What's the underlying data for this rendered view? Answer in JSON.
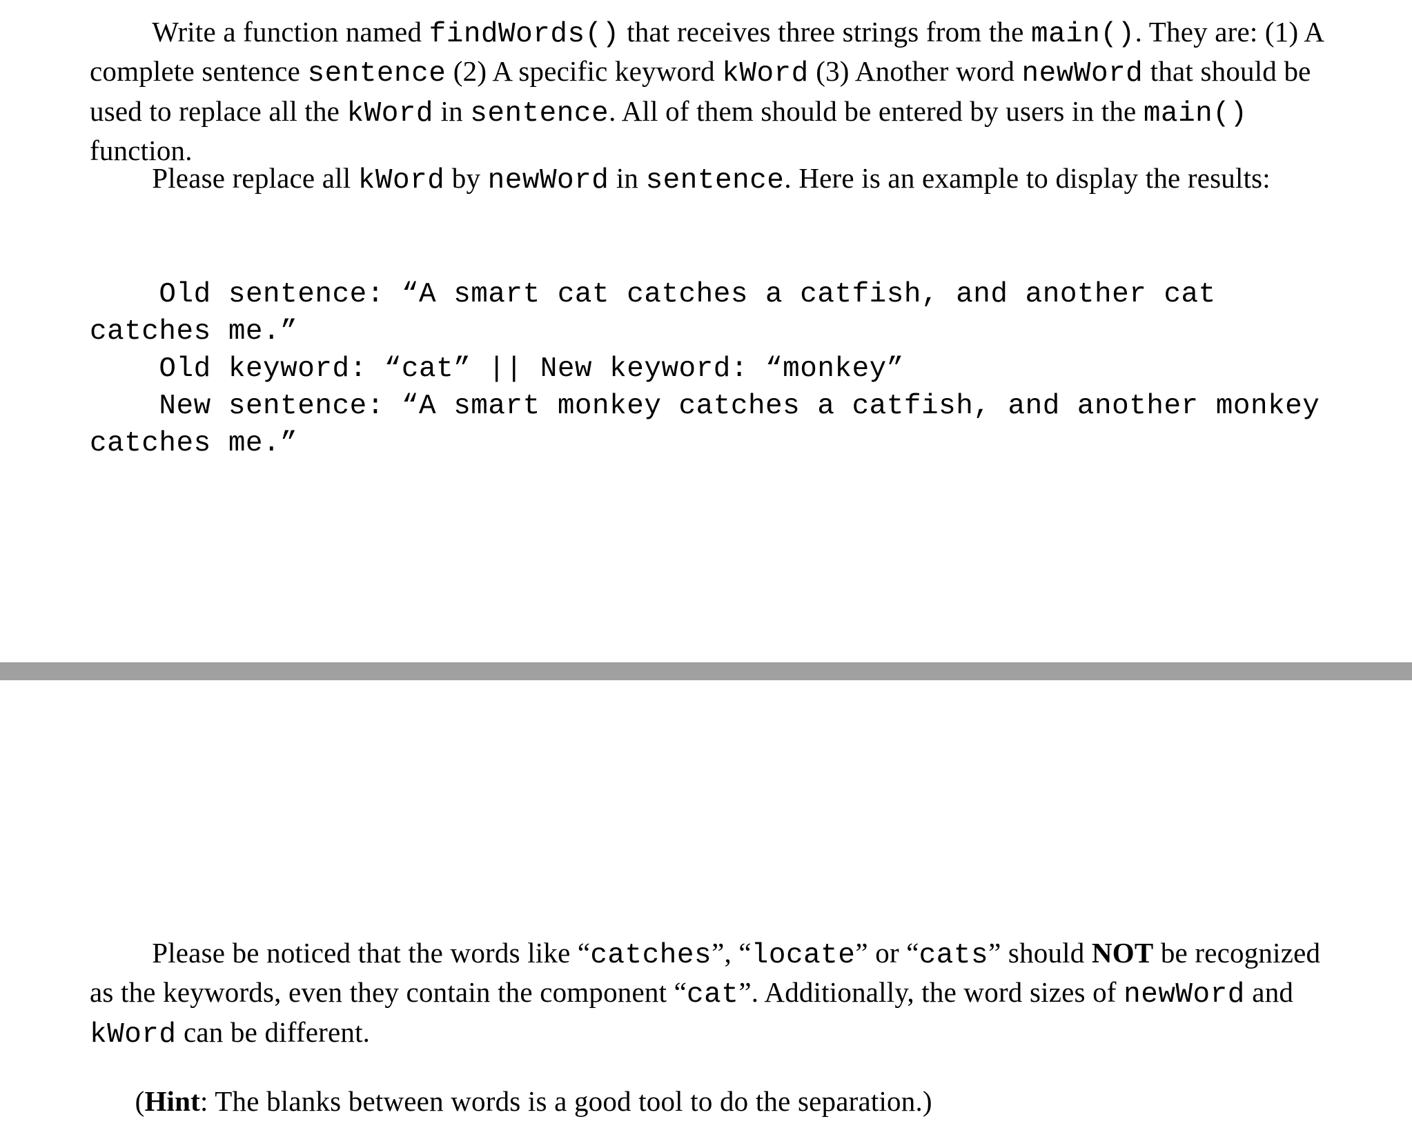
{
  "top": {
    "p1_prefix": "Write a function named ",
    "p1_fn": "findWords()",
    "p1_mid1": "  that receives three strings from the ",
    "p1_main": "main()",
    "p1_mid2": ". They are: (1) A complete sentence ",
    "p1_sentence": "sentence",
    "p1_mid3": " (2) A specific keyword ",
    "p1_kword": "kWord",
    "p1_mid4": " (3) Another word ",
    "p1_newword": "newWord",
    "p1_mid5": " that should be used to replace all the ",
    "p1_kword2": "kWord",
    "p1_mid6": " in ",
    "p1_sentence2": "sentence",
    "p1_mid7": ". All of them should be entered by users in the ",
    "p1_main2": "main()",
    "p1_tail": " function.",
    "p2_prefix": "Please replace all ",
    "p2_kword": "kWord",
    "p2_mid1": " by ",
    "p2_newword": "newWord",
    "p2_mid2": " in ",
    "p2_sentence": "sentence",
    "p2_tail": ". Here is an example to display the results:"
  },
  "example": {
    "line1": "    Old sentence: “A smart cat catches a catfish, and another cat catches me.”",
    "line2": "    Old keyword: “cat” || New keyword: “monkey”",
    "line3": "    New sentence: “A smart monkey catches a catfish, and another monkey catches me.”"
  },
  "bottom": {
    "p3_prefix": "Please be noticed that the words like “",
    "p3_w1": "catches",
    "p3_mid1": "”, “",
    "p3_w2": "locate",
    "p3_mid2": "” or “",
    "p3_w3": "cats",
    "p3_mid3": "” should ",
    "p3_not": "NOT",
    "p3_mid4": " be recognized as the keywords, even they contain the component “",
    "p3_w4": "cat",
    "p3_mid5": "”. Additionally, the word sizes of ",
    "p3_newword": "newWord",
    "p3_mid6": "  and ",
    "p3_kword": "kWord",
    "p3_mid7": "  can be different.",
    "p4_prefix": "(",
    "p4_hint": "Hint",
    "p4_body": ": The blanks between words is a good tool to do the separation.)"
  }
}
